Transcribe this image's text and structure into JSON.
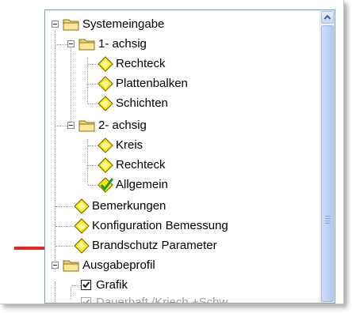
{
  "tree": {
    "nodes": [
      {
        "label": "Systemeingabe",
        "icon": "folder-icon"
      },
      {
        "label": "1- achsig",
        "icon": "folder-icon"
      },
      {
        "label": "Rechteck",
        "icon": "diamond-icon"
      },
      {
        "label": "Plattenbalken",
        "icon": "diamond-icon"
      },
      {
        "label": "Schichten",
        "icon": "diamond-icon"
      },
      {
        "label": "2- achsig",
        "icon": "folder-icon"
      },
      {
        "label": "Kreis",
        "icon": "diamond-icon"
      },
      {
        "label": "Rechteck",
        "icon": "diamond-icon"
      },
      {
        "label": "Allgemein",
        "icon": "diamond-check-icon"
      },
      {
        "label": "Bemerkungen",
        "icon": "diamond-icon"
      },
      {
        "label": "Konfiguration Bemessung",
        "icon": "diamond-icon"
      },
      {
        "label": "Brandschutz Parameter",
        "icon": "diamond-icon"
      },
      {
        "label": "Ausgabeprofil",
        "icon": "folder-icon"
      },
      {
        "label": "Grafik",
        "icon": "checkbox-checked-icon"
      },
      {
        "label": "Dauerhaft /Kriech +Schw.",
        "icon": "checkbox-checked-icon"
      }
    ]
  },
  "colors": {
    "arrow": "#e8241e",
    "folder": "#f1d56a",
    "diamond": "#ffee00",
    "checkmark": "#1a9a1a",
    "scrollbar": "#c3d3f4"
  }
}
